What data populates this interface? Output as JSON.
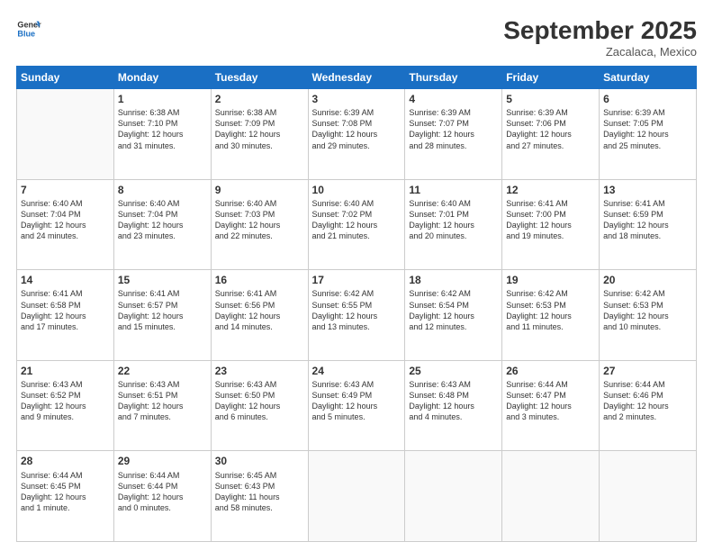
{
  "logo": {
    "line1": "General",
    "line2": "Blue"
  },
  "header": {
    "month": "September 2025",
    "location": "Zacalaca, Mexico"
  },
  "weekdays": [
    "Sunday",
    "Monday",
    "Tuesday",
    "Wednesday",
    "Thursday",
    "Friday",
    "Saturday"
  ],
  "weeks": [
    [
      {
        "day": "",
        "info": ""
      },
      {
        "day": "1",
        "info": "Sunrise: 6:38 AM\nSunset: 7:10 PM\nDaylight: 12 hours\nand 31 minutes."
      },
      {
        "day": "2",
        "info": "Sunrise: 6:38 AM\nSunset: 7:09 PM\nDaylight: 12 hours\nand 30 minutes."
      },
      {
        "day": "3",
        "info": "Sunrise: 6:39 AM\nSunset: 7:08 PM\nDaylight: 12 hours\nand 29 minutes."
      },
      {
        "day": "4",
        "info": "Sunrise: 6:39 AM\nSunset: 7:07 PM\nDaylight: 12 hours\nand 28 minutes."
      },
      {
        "day": "5",
        "info": "Sunrise: 6:39 AM\nSunset: 7:06 PM\nDaylight: 12 hours\nand 27 minutes."
      },
      {
        "day": "6",
        "info": "Sunrise: 6:39 AM\nSunset: 7:05 PM\nDaylight: 12 hours\nand 25 minutes."
      }
    ],
    [
      {
        "day": "7",
        "info": "Sunrise: 6:40 AM\nSunset: 7:04 PM\nDaylight: 12 hours\nand 24 minutes."
      },
      {
        "day": "8",
        "info": "Sunrise: 6:40 AM\nSunset: 7:04 PM\nDaylight: 12 hours\nand 23 minutes."
      },
      {
        "day": "9",
        "info": "Sunrise: 6:40 AM\nSunset: 7:03 PM\nDaylight: 12 hours\nand 22 minutes."
      },
      {
        "day": "10",
        "info": "Sunrise: 6:40 AM\nSunset: 7:02 PM\nDaylight: 12 hours\nand 21 minutes."
      },
      {
        "day": "11",
        "info": "Sunrise: 6:40 AM\nSunset: 7:01 PM\nDaylight: 12 hours\nand 20 minutes."
      },
      {
        "day": "12",
        "info": "Sunrise: 6:41 AM\nSunset: 7:00 PM\nDaylight: 12 hours\nand 19 minutes."
      },
      {
        "day": "13",
        "info": "Sunrise: 6:41 AM\nSunset: 6:59 PM\nDaylight: 12 hours\nand 18 minutes."
      }
    ],
    [
      {
        "day": "14",
        "info": "Sunrise: 6:41 AM\nSunset: 6:58 PM\nDaylight: 12 hours\nand 17 minutes."
      },
      {
        "day": "15",
        "info": "Sunrise: 6:41 AM\nSunset: 6:57 PM\nDaylight: 12 hours\nand 15 minutes."
      },
      {
        "day": "16",
        "info": "Sunrise: 6:41 AM\nSunset: 6:56 PM\nDaylight: 12 hours\nand 14 minutes."
      },
      {
        "day": "17",
        "info": "Sunrise: 6:42 AM\nSunset: 6:55 PM\nDaylight: 12 hours\nand 13 minutes."
      },
      {
        "day": "18",
        "info": "Sunrise: 6:42 AM\nSunset: 6:54 PM\nDaylight: 12 hours\nand 12 minutes."
      },
      {
        "day": "19",
        "info": "Sunrise: 6:42 AM\nSunset: 6:53 PM\nDaylight: 12 hours\nand 11 minutes."
      },
      {
        "day": "20",
        "info": "Sunrise: 6:42 AM\nSunset: 6:53 PM\nDaylight: 12 hours\nand 10 minutes."
      }
    ],
    [
      {
        "day": "21",
        "info": "Sunrise: 6:43 AM\nSunset: 6:52 PM\nDaylight: 12 hours\nand 9 minutes."
      },
      {
        "day": "22",
        "info": "Sunrise: 6:43 AM\nSunset: 6:51 PM\nDaylight: 12 hours\nand 7 minutes."
      },
      {
        "day": "23",
        "info": "Sunrise: 6:43 AM\nSunset: 6:50 PM\nDaylight: 12 hours\nand 6 minutes."
      },
      {
        "day": "24",
        "info": "Sunrise: 6:43 AM\nSunset: 6:49 PM\nDaylight: 12 hours\nand 5 minutes."
      },
      {
        "day": "25",
        "info": "Sunrise: 6:43 AM\nSunset: 6:48 PM\nDaylight: 12 hours\nand 4 minutes."
      },
      {
        "day": "26",
        "info": "Sunrise: 6:44 AM\nSunset: 6:47 PM\nDaylight: 12 hours\nand 3 minutes."
      },
      {
        "day": "27",
        "info": "Sunrise: 6:44 AM\nSunset: 6:46 PM\nDaylight: 12 hours\nand 2 minutes."
      }
    ],
    [
      {
        "day": "28",
        "info": "Sunrise: 6:44 AM\nSunset: 6:45 PM\nDaylight: 12 hours\nand 1 minute."
      },
      {
        "day": "29",
        "info": "Sunrise: 6:44 AM\nSunset: 6:44 PM\nDaylight: 12 hours\nand 0 minutes."
      },
      {
        "day": "30",
        "info": "Sunrise: 6:45 AM\nSunset: 6:43 PM\nDaylight: 11 hours\nand 58 minutes."
      },
      {
        "day": "",
        "info": ""
      },
      {
        "day": "",
        "info": ""
      },
      {
        "day": "",
        "info": ""
      },
      {
        "day": "",
        "info": ""
      }
    ]
  ]
}
